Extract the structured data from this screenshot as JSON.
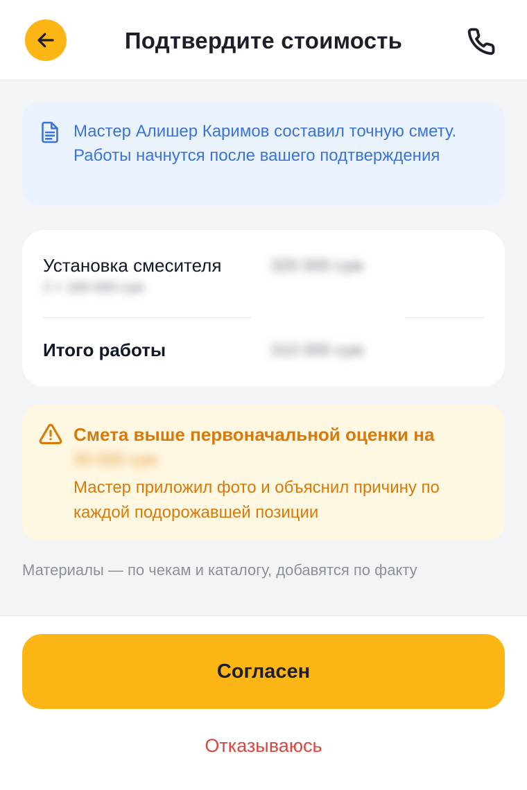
{
  "header": {
    "title": "Подтвердите стоимость"
  },
  "info": {
    "text": "Мастер Алишер Каримов составил точную смету. Работы начнутся после вашего подтверждения"
  },
  "estimate": {
    "items": [
      {
        "label": "Установка смесителя",
        "amount": "320 000 сум",
        "note": "2 × 160 000 сум"
      }
    ],
    "total_label": "Итого работы",
    "total_amount": "310 000 сум"
  },
  "warning": {
    "title": "Смета выше первоначальной оценки на",
    "difference": "30 000 сум",
    "text": "Мастер приложил фото и объяснил причину по каждой подорожавшей позиции"
  },
  "note": "Материалы — по чекам и каталогу, добавятся по факту",
  "actions": {
    "agree_label": "Согласен",
    "refuse_label": "Отказываюсь"
  },
  "colors": {
    "accent": "#FBB515",
    "info_text": "#3B73D9",
    "warning_text": "#D77A0A",
    "danger": "#D9463E"
  }
}
